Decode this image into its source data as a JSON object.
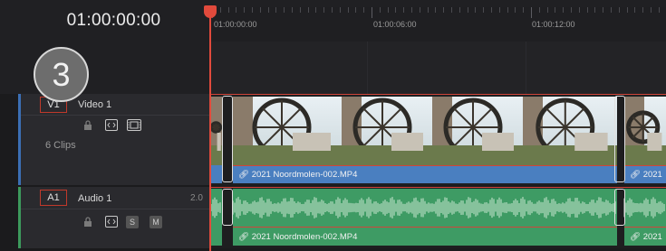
{
  "timecode": "01:00:00:00",
  "step_badge": "3",
  "ruler": {
    "labels": [
      "01:00:00:00",
      "01:00:06:00",
      "01:00:12:00"
    ]
  },
  "video_track": {
    "id": "V1",
    "name": "Video 1",
    "clip_count": "6 Clips",
    "clip_label": "2021 Noordmolen-002.MP4",
    "clip_label_short": "2021"
  },
  "audio_track": {
    "id": "A1",
    "name": "Audio 1",
    "level": "2.0",
    "solo_label": "S",
    "mute_label": "M",
    "clip_label": "2021 Noordmolen-002.MP4",
    "clip_label_short": "2021"
  },
  "colors": {
    "video_track": "#3b6fb5",
    "audio_track": "#3c9a5c",
    "video_clip_bar": "#4a7fc0",
    "audio_clip": "#3e9b64",
    "playhead": "#e14a3c"
  },
  "icons": [
    "lock-icon",
    "auto-select-icon",
    "filmstrip-icon",
    "link-icon"
  ]
}
